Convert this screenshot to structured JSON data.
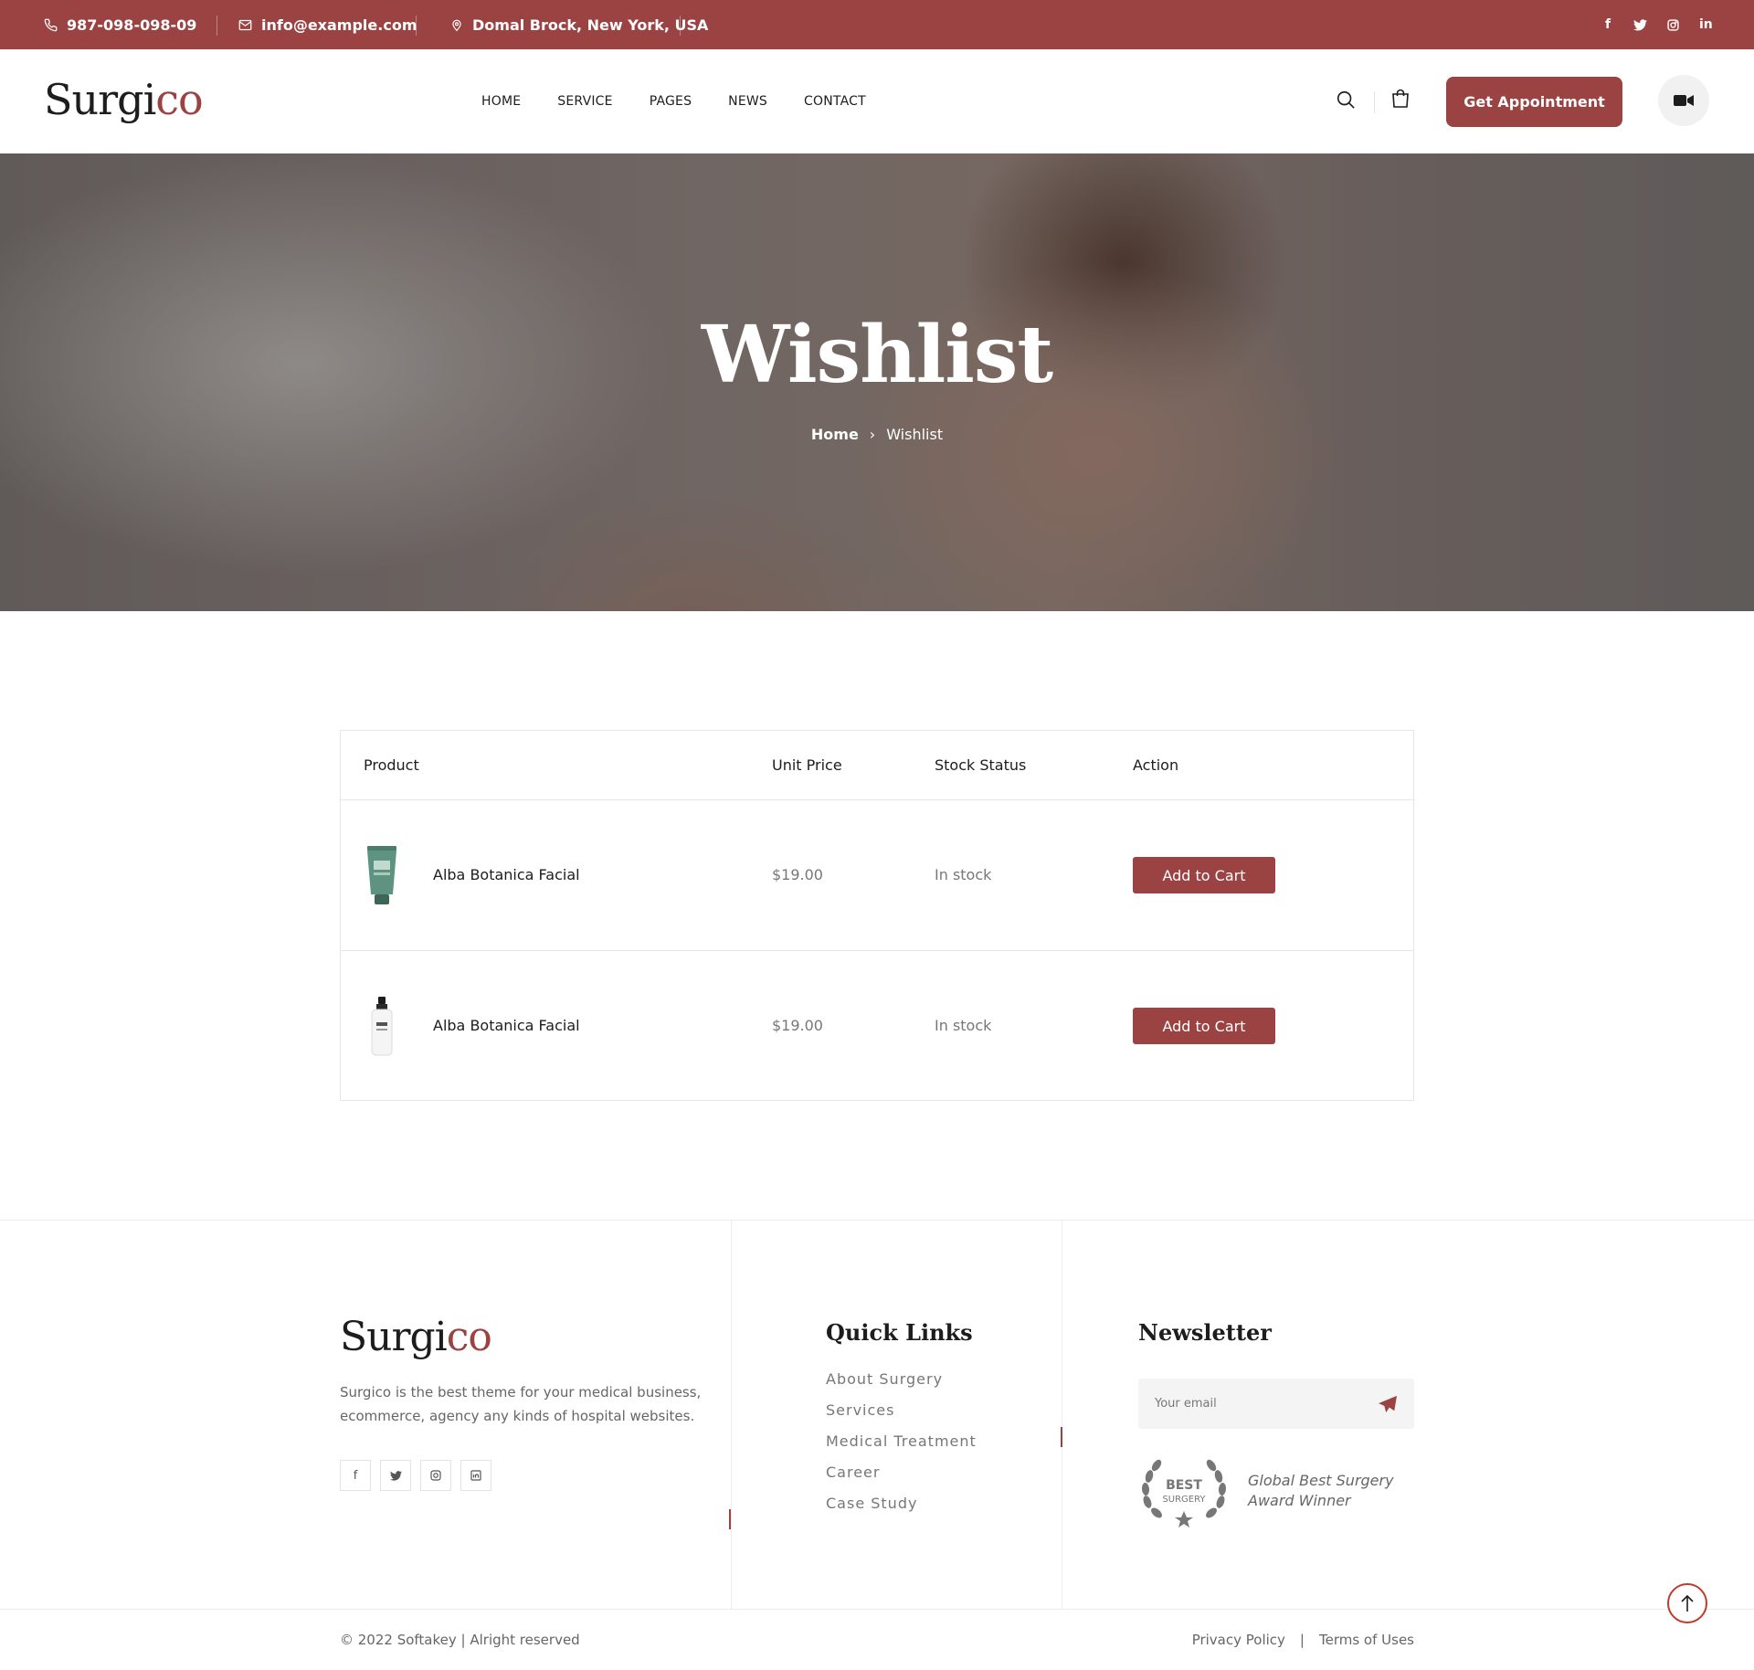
{
  "topbar": {
    "phone": "987-098-098-09",
    "email": "info@example.com",
    "address": "Domal Brock, New York, USA",
    "socials": [
      "facebook-icon",
      "twitter-icon",
      "instagram-icon",
      "linkedin-icon"
    ],
    "facebook_glyph": "f",
    "linkedin_glyph": "in"
  },
  "header": {
    "logo_part1": "Surgi",
    "logo_part2": "co",
    "nav": [
      "HOME",
      "SERVICE",
      "PAGES",
      "NEWS",
      "CONTACT"
    ],
    "appointment_button": "Get Appointment"
  },
  "hero": {
    "title": "Wishlist",
    "breadcrumb_home": "Home",
    "breadcrumb_separator": "›",
    "breadcrumb_current": "Wishlist"
  },
  "wishlist": {
    "columns": [
      "Product",
      "Unit Price",
      "Stock Status",
      "Action"
    ],
    "rows": [
      {
        "product": "Alba Botanica Facial",
        "price": "$19.00",
        "stock": "In stock",
        "action": "Add to Cart",
        "image": "green-tube-product"
      },
      {
        "product": "Alba Botanica Facial",
        "price": "$19.00",
        "stock": "In stock",
        "action": "Add to Cart",
        "image": "white-bottle-product"
      }
    ]
  },
  "footer": {
    "logo_part1": "Surgi",
    "logo_part2": "co",
    "description": "Surgico is the best theme for your medical business, ecommerce, agency any kinds of hospital websites.",
    "socials": [
      "facebook-icon",
      "twitter-icon",
      "instagram-icon",
      "linkedin-icon"
    ],
    "quick_links_title": "Quick Links",
    "quick_links": [
      "About Surgery",
      "Services",
      "Medical Treatment",
      "Career",
      "Case Study"
    ],
    "newsletter_title": "Newsletter",
    "email_placeholder": "Your email",
    "award_badge_line1": "BEST",
    "award_badge_line2": "SURGERY",
    "award_line1": "Global Best Surgery",
    "award_line2": "Award Winner",
    "copyright": "© 2022 Softakey | Alright reserved",
    "privacy": "Privacy Policy",
    "legal_separator": "|",
    "terms": "Terms of Uses"
  },
  "colors": {
    "brand": "#9b4242",
    "totop_accent": "#c23a2a"
  }
}
